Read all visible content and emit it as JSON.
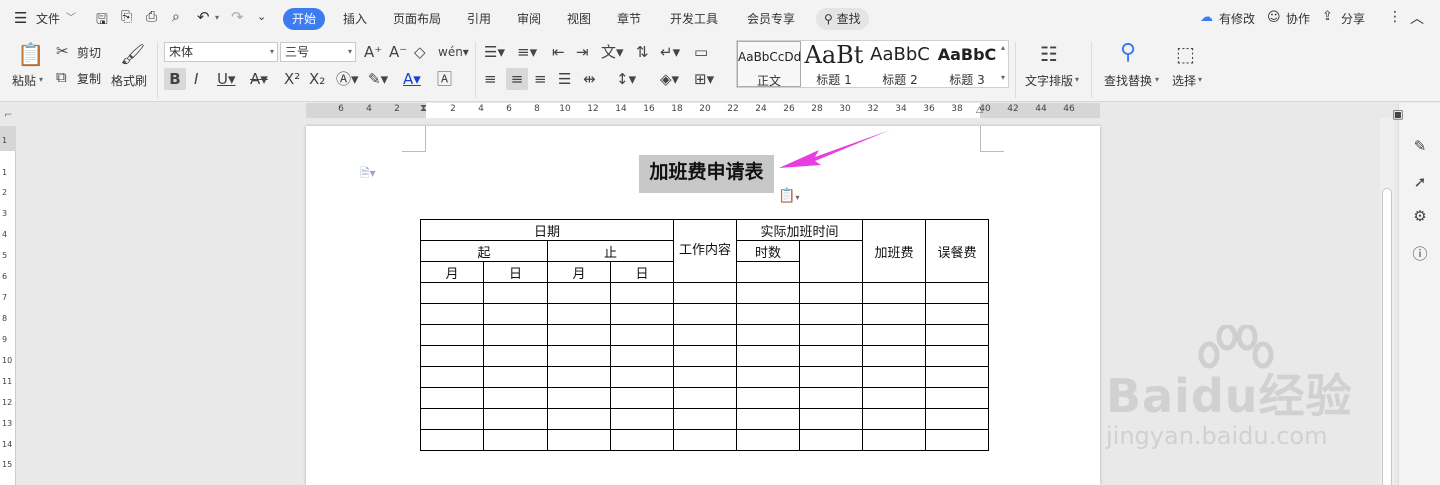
{
  "menu": {
    "file": "文件",
    "tabs": [
      "开始",
      "插入",
      "页面布局",
      "引用",
      "审阅",
      "视图",
      "章节",
      "开发工具",
      "会员专享"
    ],
    "search": "查找",
    "modified": "有修改",
    "collab": "协作",
    "share": "分享"
  },
  "ribbon": {
    "paste": "粘贴",
    "cut": "剪切",
    "copy": "复制",
    "format_painter": "格式刷",
    "font_name": "宋体",
    "font_size": "三号",
    "styles": [
      {
        "preview": "AaBbCcDd",
        "label": "正文"
      },
      {
        "preview": "AaBt",
        "label": "标题 1"
      },
      {
        "preview": "AaBbC",
        "label": "标题 2"
      },
      {
        "preview": "AaBbC",
        "label": "标题 3"
      }
    ],
    "text_layout": "文字排版",
    "find_replace": "查找替换",
    "select": "选择"
  },
  "ruler": {
    "h_ticks": [
      "6",
      "4",
      "2",
      "2",
      "4",
      "6",
      "8",
      "10",
      "12",
      "14",
      "16",
      "18",
      "20",
      "22",
      "24",
      "26",
      "28",
      "30",
      "32",
      "34",
      "36",
      "38",
      "40",
      "42",
      "44",
      "46"
    ],
    "v_ticks": [
      "1",
      "1",
      "2",
      "3",
      "4",
      "5",
      "6",
      "7",
      "8",
      "9",
      "10",
      "11",
      "12",
      "13",
      "14",
      "15"
    ]
  },
  "document": {
    "title": "加班费申请表",
    "table": {
      "date": "日期",
      "start": "起",
      "end": "止",
      "month": "月",
      "day": "日",
      "work_content": "工作内容",
      "actual_overtime": "实际加班时间",
      "hours": "时数",
      "overtime_pay": "加班费",
      "meal_fee": "误餐费"
    }
  },
  "watermark": {
    "brand": "Baidu经验",
    "url": "jingyan.baidu.com"
  },
  "colors": {
    "accent": "#3c7bf0",
    "arrow": "#e83ee0"
  }
}
